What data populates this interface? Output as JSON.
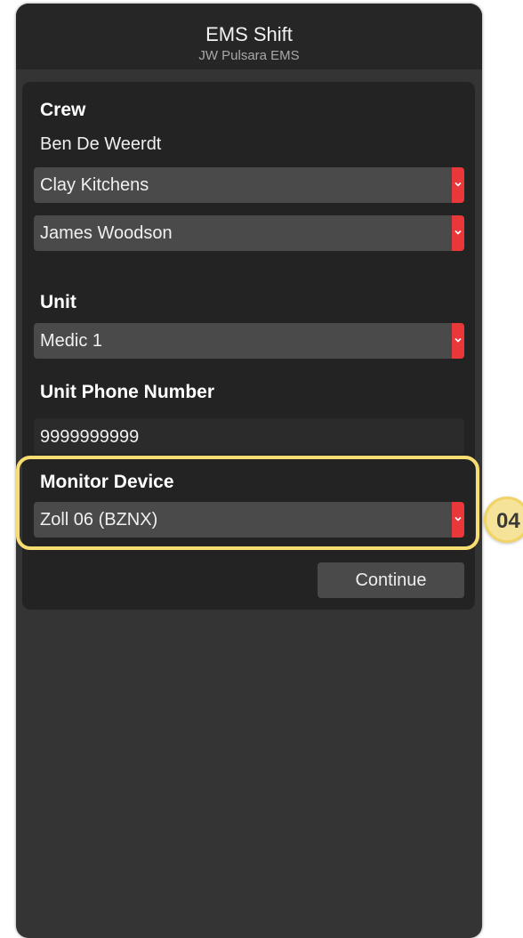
{
  "header": {
    "title": "EMS Shift",
    "subtitle": "JW Pulsara EMS"
  },
  "crew": {
    "heading": "Crew",
    "lead": "Ben De Weerdt",
    "members": [
      "Clay Kitchens",
      "James Woodson"
    ]
  },
  "unit": {
    "heading": "Unit",
    "selected": "Medic 1"
  },
  "unit_phone": {
    "heading": "Unit Phone Number",
    "value": "9999999999"
  },
  "monitor": {
    "heading": "Monitor Device",
    "selected": "Zoll 06 (BZNX)"
  },
  "actions": {
    "continue_label": "Continue"
  },
  "annotation": {
    "badge": "04",
    "highlight_color": "#f7dd72"
  },
  "colors": {
    "background": "#343434",
    "card": "#232323",
    "select": "#4a4a4a",
    "select_caret": "#e8383a"
  },
  "icons": {
    "select_caret": "chevron-down-icon"
  }
}
